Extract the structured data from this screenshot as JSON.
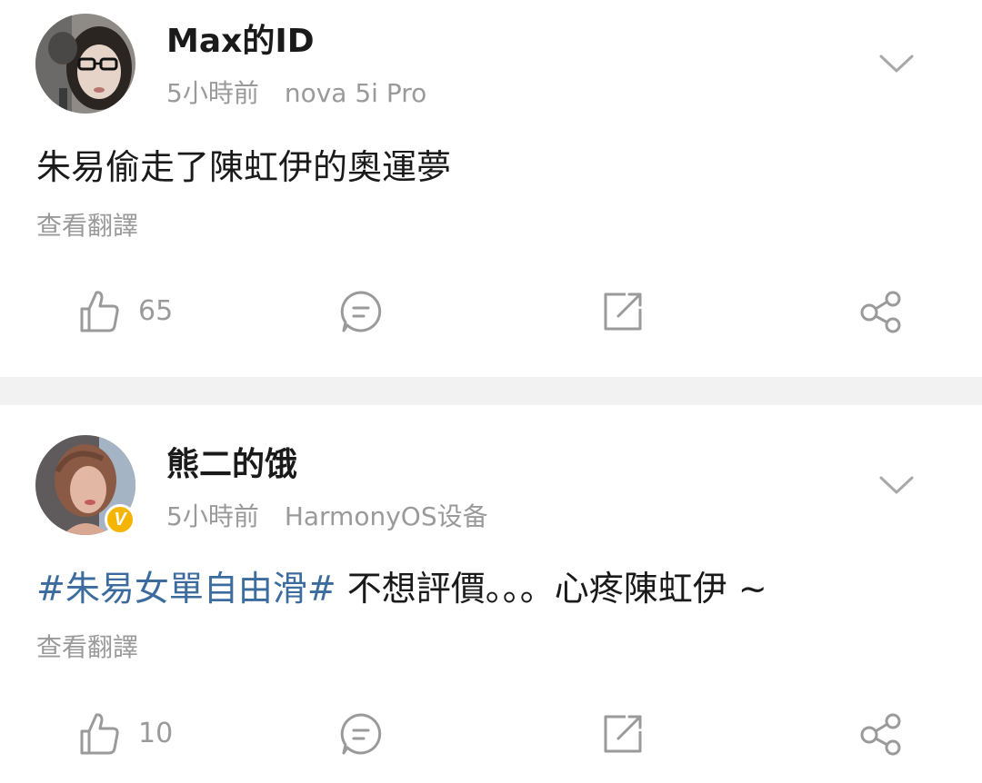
{
  "posts": [
    {
      "username": "Max的ID",
      "time": "5小時前",
      "source": "nova 5i Pro",
      "text": "朱易偷走了陳虹伊的奧運夢",
      "translate_label": "查看翻譯",
      "likes": "65",
      "verified": false
    },
    {
      "username": "熊二的饿",
      "time": "5小時前",
      "source": "HarmonyOS设备",
      "hashtag": "#朱易女單自由滑#",
      "text": " 不想評價。。。心疼陳虹伊 ~",
      "translate_label": "查看翻譯",
      "likes": "10",
      "verified": true,
      "verified_badge": "V"
    }
  ],
  "icons": {
    "like": "thumbs-up-icon",
    "comment": "comment-icon",
    "repost": "repost-icon",
    "share": "share-icon",
    "more": "chevron-down-icon"
  },
  "colors": {
    "hashtag": "#3c6c9e",
    "muted": "#9a9a9a",
    "text": "#1a1a1a",
    "separator": "#f2f2f2",
    "verified_badge": "#f5b400"
  }
}
